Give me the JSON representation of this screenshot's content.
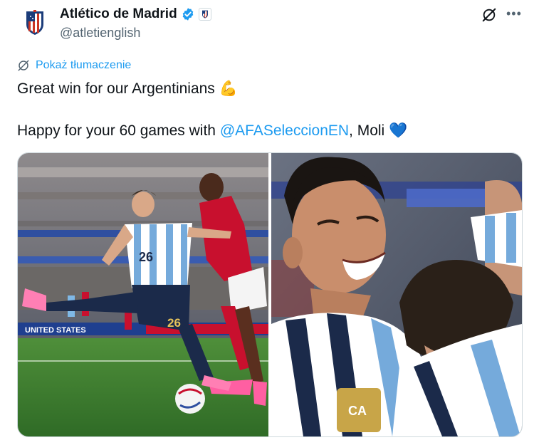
{
  "author": {
    "display_name": "Atlético de Madrid",
    "handle": "@atletienglish",
    "verified_badge_color": "#1d9bf0",
    "avatar_icon": "atletico-crest-icon"
  },
  "header_actions": {
    "grok_icon": "grok-icon",
    "more_label": "•••"
  },
  "translate": {
    "label": "Pokaż tłumaczenie",
    "icon": "translate-globe-icon"
  },
  "body": {
    "line1_text": "Great win for our Argentinians",
    "line1_emoji": "💪",
    "line2_prefix": "Happy for your 60 games with",
    "line2_mention": "@AFASeleccionEN",
    "line2_suffix": ", Moli",
    "line2_emoji": "💙"
  },
  "media": {
    "photo_count": 2,
    "left_jersey_number": "26",
    "left_shorts_number": "26"
  },
  "colors": {
    "link": "#1d9bf0",
    "text": "#0f1419",
    "muted": "#536471",
    "border": "#cfd9de"
  }
}
